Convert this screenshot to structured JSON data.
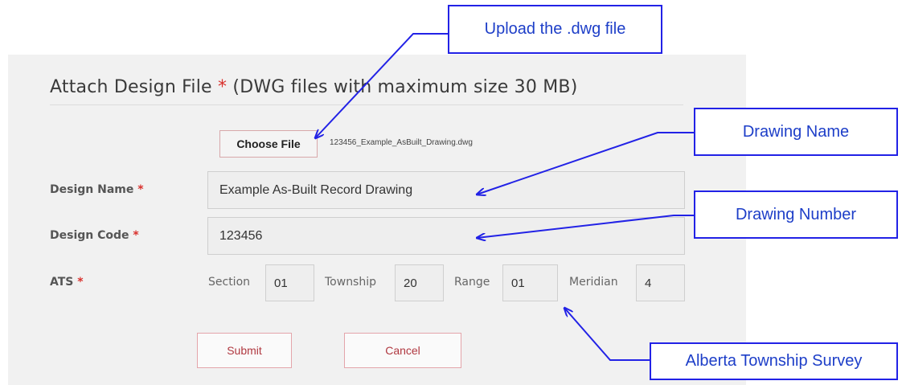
{
  "form": {
    "title": "Attach Design File",
    "title_required": "*",
    "title_note": "(DWG files with maximum size 30 MB)",
    "choose_file_label": "Choose File",
    "selected_file": "123456_Example_AsBuilt_Drawing.dwg",
    "design_name_label": "Design Name",
    "design_name_value": "Example As-Built Record Drawing",
    "design_code_label": "Design Code",
    "design_code_value": "123456",
    "ats_label": "ATS",
    "required_mark": "*",
    "ats": {
      "section_label": "Section",
      "section_value": "01",
      "township_label": "Township",
      "township_value": "20",
      "range_label": "Range",
      "range_value": "01",
      "meridian_label": "Meridian",
      "meridian_value": "4"
    },
    "submit_label": "Submit",
    "cancel_label": "Cancel"
  },
  "annotations": {
    "upload": "Upload the .dwg file",
    "drawing_name": "Drawing Name",
    "drawing_number": "Drawing Number",
    "ats_survey": "Alberta Township Survey"
  },
  "colors": {
    "required": "#d9302c",
    "annotation_border": "#2222e6",
    "annotation_text": "#1d3ec8",
    "button_border": "#e4a5aa"
  }
}
